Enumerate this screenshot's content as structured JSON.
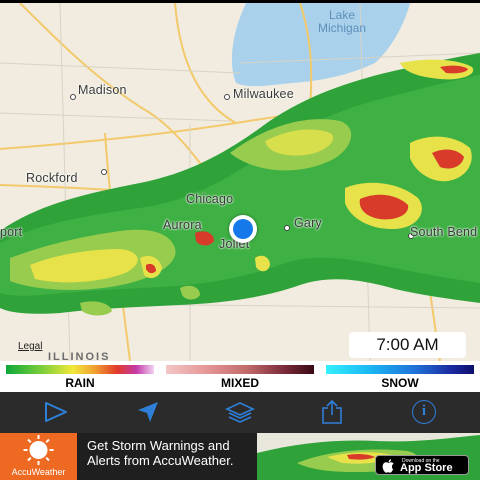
{
  "map": {
    "cities": [
      "Madison",
      "Milwaukee",
      "Rockford",
      "Chicago",
      "Aurora",
      "Joliet",
      "Gary",
      "South Bend",
      "port"
    ],
    "lake_label_line1": "Lake",
    "lake_label_line2": "Michigan",
    "state_label": "ILLINOIS",
    "legal_link": "Legal",
    "timestamp": "7:00 AM",
    "colors": {
      "land": "#f1ecdf",
      "water": "#a9d1ec",
      "radar_green": "#2fa33a",
      "radar_yellow": "#e7e24a",
      "radar_red": "#d93b2b"
    }
  },
  "legend": {
    "rain": "RAIN",
    "mixed": "MIXED",
    "snow": "SNOW"
  },
  "toolbar": {
    "buttons": [
      "play-icon",
      "location-arrow-icon",
      "layers-icon",
      "share-icon",
      "info-icon"
    ],
    "info_glyph": "i",
    "accent": "#2f7fd8"
  },
  "ad": {
    "brand": "AccuWeather",
    "headline": "Get Storm Warnings and Alerts from AccuWeather.",
    "store_small": "Download on the",
    "store_big": "App Store"
  }
}
